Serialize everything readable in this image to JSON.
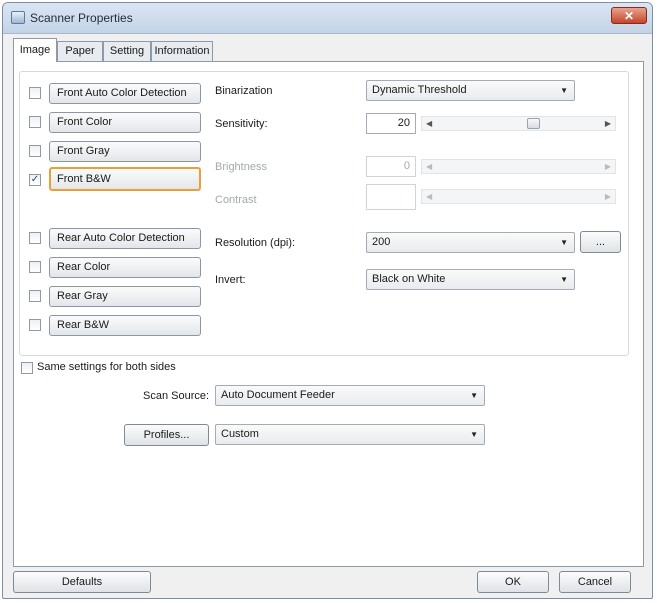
{
  "window": {
    "title": "Scanner Properties",
    "close_glyph": "✕"
  },
  "tabs": [
    "Image",
    "Paper",
    "Setting",
    "Information"
  ],
  "image_types": [
    {
      "label": "Front Auto Color Detection",
      "checked": false
    },
    {
      "label": "Front Color",
      "checked": false
    },
    {
      "label": "Front Gray",
      "checked": false
    },
    {
      "label": "Front B&W",
      "checked": true,
      "selected": true
    },
    {
      "label": "Rear Auto Color Detection",
      "checked": false
    },
    {
      "label": "Rear Color",
      "checked": false
    },
    {
      "label": "Rear Gray",
      "checked": false
    },
    {
      "label": "Rear B&W",
      "checked": false
    }
  ],
  "settings": {
    "binarization": {
      "label": "Binarization",
      "value": "Dynamic Threshold"
    },
    "sensitivity": {
      "label": "Sensitivity:",
      "value": "20",
      "level": 0.6
    },
    "brightness": {
      "label": "Brightness",
      "value": "0"
    },
    "contrast": {
      "label": "Contrast",
      "value": ""
    },
    "resolution": {
      "label": "Resolution (dpi):",
      "value": "200",
      "more_label": "..."
    },
    "invert": {
      "label": "Invert:",
      "value": "Black on White"
    }
  },
  "same_settings": {
    "label": "Same settings for both sides",
    "checked": false
  },
  "scan_source": {
    "label": "Scan Source:",
    "value": "Auto Document Feeder"
  },
  "profiles": {
    "button_label": "Profiles...",
    "value": "Custom"
  },
  "footer": {
    "defaults_label": "Defaults",
    "ok_label": "OK",
    "cancel_label": "Cancel"
  },
  "glyphs": {
    "arrow_down": "▼",
    "arrow_left": "◀",
    "arrow_right": "▶",
    "check": "✓"
  }
}
